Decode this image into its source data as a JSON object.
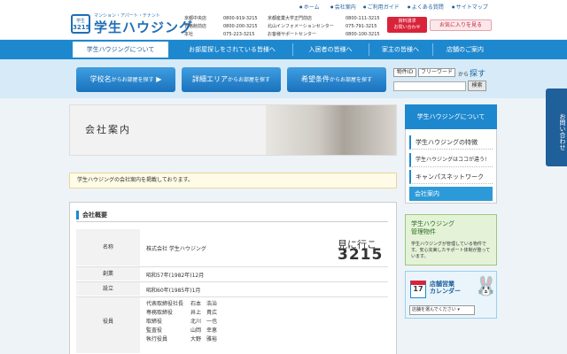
{
  "top_links": [
    "ホーム",
    "会社案内",
    "ご利用ガイド",
    "よくある質問",
    "サイトマップ"
  ],
  "logo": {
    "badge_top": "学生",
    "badge_bottom": "3215",
    "tagline": "マンション・アパート・テナント",
    "name": "学生ハウジング"
  },
  "offices": [
    {
      "name": "京都中央店",
      "phone": "0800-919-3215"
    },
    {
      "name": "合格館前店",
      "phone": "0800-200-3215"
    },
    {
      "name": "本社",
      "phone": "075-223-3215"
    },
    {
      "name": "京都産業大学正門前店",
      "phone": "0800-111-3215"
    },
    {
      "name": "北山インフォメーションセンター",
      "phone": "075-791-3215"
    },
    {
      "name": "お客様サポートセンター",
      "phone": "0800-100-3215"
    }
  ],
  "header_buttons": {
    "request": "資料請求\nお問い合わせ",
    "favorites": "お気に入りを見る"
  },
  "nav": [
    "学生ハウジングについて",
    "お部屋探しをされている皆様へ",
    "入居者の皆様へ",
    "家主の皆様へ",
    "店舗のご案内"
  ],
  "search": {
    "school_button": "学校名",
    "school_suffix": "からお部屋を探す",
    "area_button": "詳細エリア",
    "area_suffix": "からお部屋を探す",
    "cond_button": "希望条件",
    "cond_suffix": "からお部屋を探す",
    "tag_id": "物件ID",
    "tag_free": "フリーワード",
    "tag_from": "から",
    "tag_search": "探す",
    "submit": "検索"
  },
  "page": {
    "title": "会社案内",
    "notice": "学生ハウジングの会社案内を掲載しております。"
  },
  "company": {
    "section_title": "会社概要",
    "rows": [
      {
        "label": "名称",
        "value": "株式会社 学生ハウジング"
      },
      {
        "label": "創業",
        "value": "昭和57年(1982年)12月"
      },
      {
        "label": "設立",
        "value": "昭和60年(1985年)1月"
      }
    ],
    "officers_label": "役員",
    "officers": [
      {
        "title": "代表取締役社長",
        "name": "石本　浩治"
      },
      {
        "title": "専務取締役",
        "name": "井上　貴広"
      },
      {
        "title": "取締役",
        "name": "北川　一也"
      },
      {
        "title": "監査役",
        "name": "山岡　幸恵"
      },
      {
        "title": "執行役員",
        "name": "大野　雅裕"
      }
    ],
    "visit_line1": "見に行こ",
    "visit_line2": "3215"
  },
  "sidebar": {
    "heading": "学生ハウジングについて",
    "items": [
      "学生ハウジングの特徴",
      "学生ハウジングはココが違う!",
      "キャンパスネットワーク"
    ],
    "active": "会社案内",
    "banner_props_title": "学生ハウジング\n管理物件",
    "banner_props_text": "学生ハウジングが管理している物件です。安心充実したサポート体制が整っています。",
    "banner_cal_title": "店舗営業\nカレンダー",
    "banner_cal_day": "17",
    "banner_cal_select": "店舗を選んでください"
  },
  "side_tab": "お問い合わせ",
  "colors": {
    "brand": "#1e88cf",
    "accent_red": "#d9233a"
  }
}
